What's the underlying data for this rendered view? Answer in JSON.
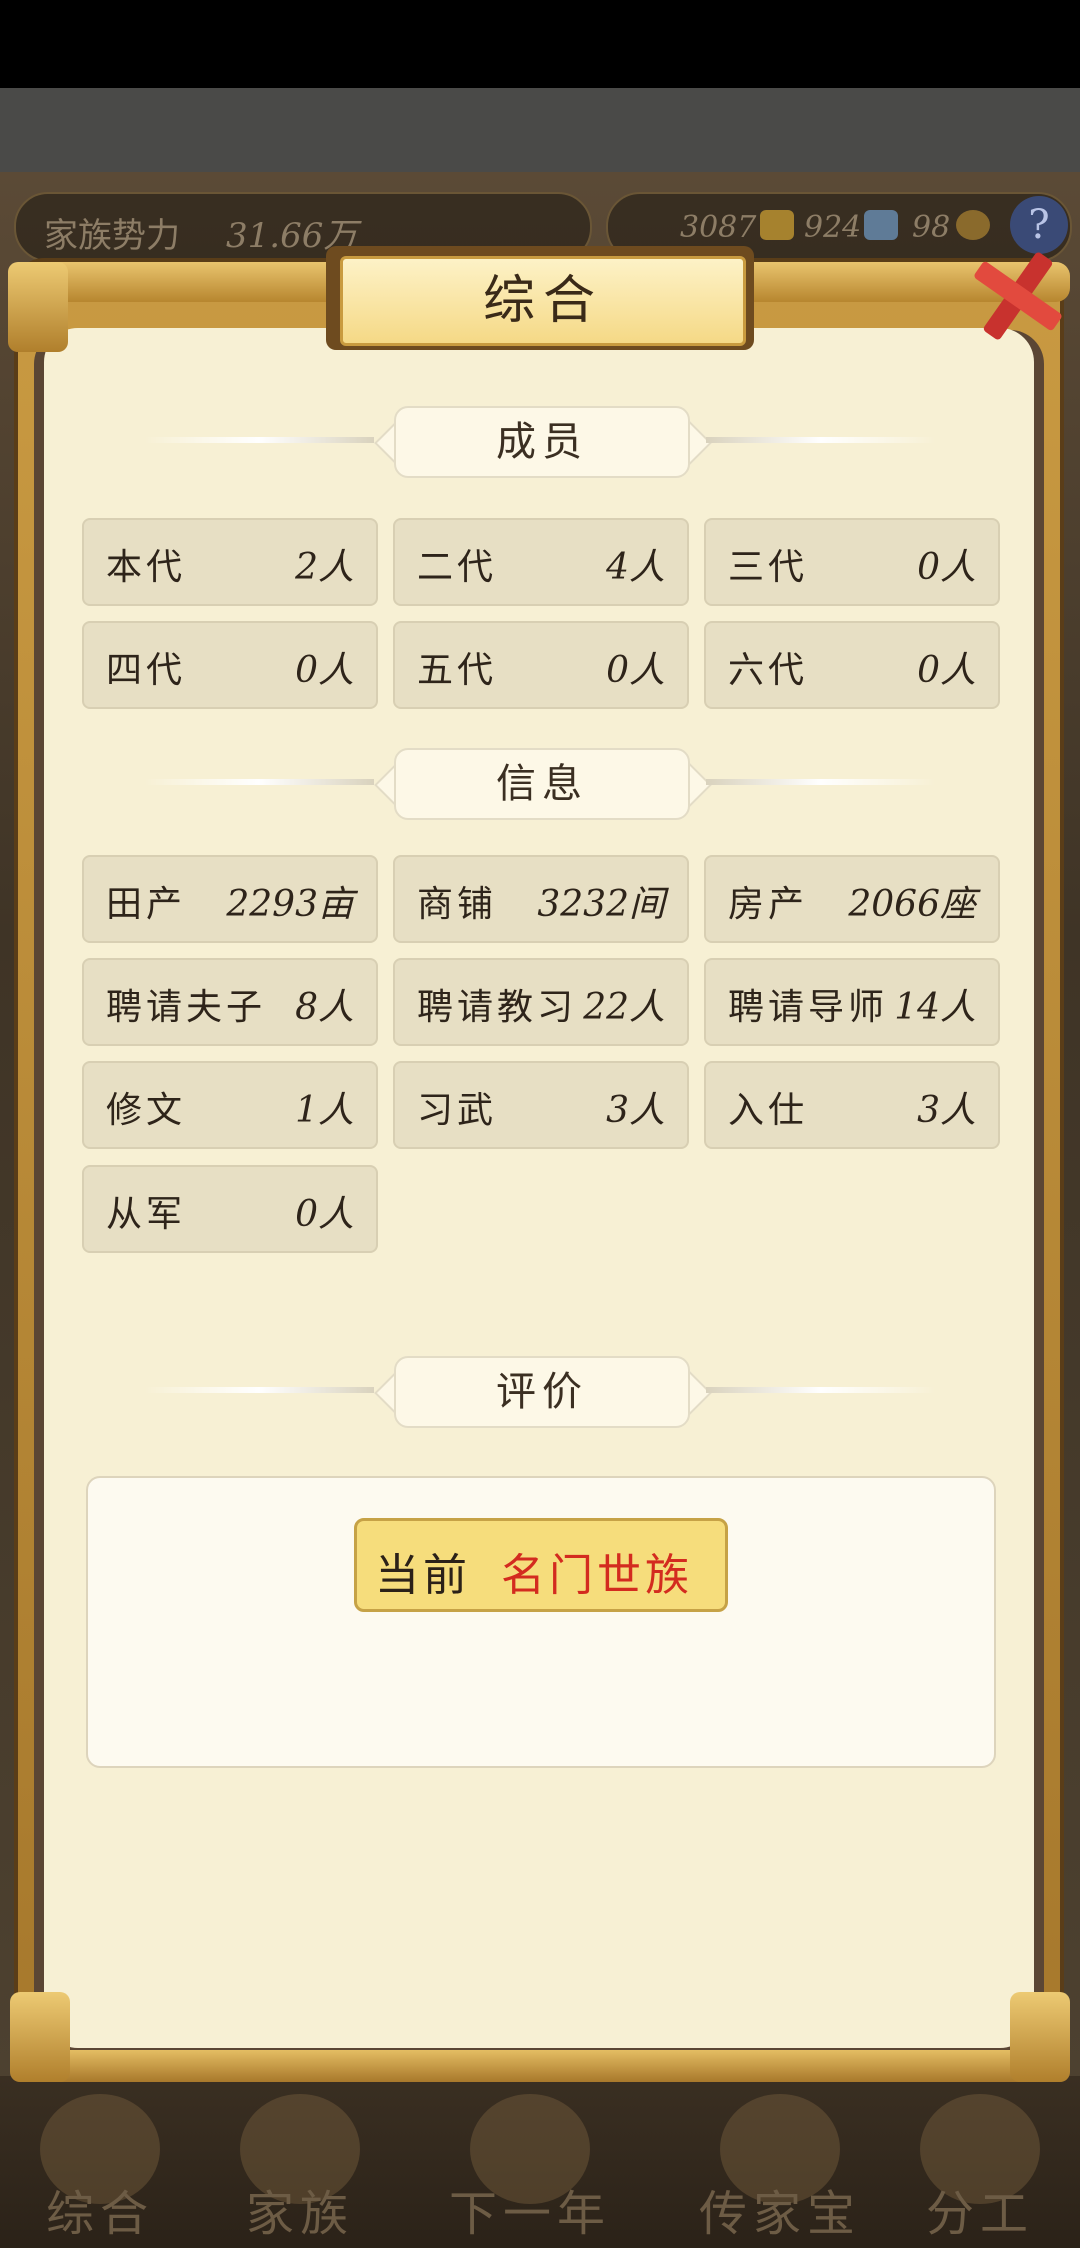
{
  "hud": {
    "influence_label": "家族势力",
    "influence_value": "31.66万",
    "resources": [
      {
        "icon": "gold-ingot-icon",
        "value": "3087"
      },
      {
        "icon": "silver-ingot-icon",
        "value": "924"
      },
      {
        "icon": "copper-coin-icon",
        "value": "98"
      }
    ],
    "help_label": "?"
  },
  "panel": {
    "title": "综合",
    "members_header": "成员",
    "members": [
      {
        "label": "本代",
        "value": "2人"
      },
      {
        "label": "二代",
        "value": "4人"
      },
      {
        "label": "三代",
        "value": "0人"
      },
      {
        "label": "四代",
        "value": "0人"
      },
      {
        "label": "五代",
        "value": "0人"
      },
      {
        "label": "六代",
        "value": "0人"
      }
    ],
    "info_header": "信息",
    "info": [
      {
        "label": "田产",
        "value": "2293亩"
      },
      {
        "label": "商铺",
        "value": "3232间"
      },
      {
        "label": "房产",
        "value": "2066座"
      },
      {
        "label": "聘请夫子",
        "value": "8人"
      },
      {
        "label": "聘请教习",
        "value": "22人"
      },
      {
        "label": "聘请导师",
        "value": "14人"
      },
      {
        "label": "修文",
        "value": "1人"
      },
      {
        "label": "习武",
        "value": "3人"
      },
      {
        "label": "入仕",
        "value": "3人"
      },
      {
        "label": "从军",
        "value": "0人"
      }
    ],
    "eval_header": "评价",
    "eval_label": "当前",
    "eval_value": "名门世族"
  },
  "bottom_nav": [
    {
      "label": "综合",
      "icon": "scroll-icon"
    },
    {
      "label": "家族",
      "icon": "house-icon"
    },
    {
      "label": "下一年",
      "icon": "mountain-icon"
    },
    {
      "label": "传家宝",
      "icon": "treasure-icon"
    },
    {
      "label": "分工",
      "icon": "person-icon"
    }
  ],
  "colors": {
    "paper": "#f7f0d4",
    "cell": "#e7dfc4",
    "frame_gold": "#c99a42",
    "accent_red": "#d32b1f"
  }
}
